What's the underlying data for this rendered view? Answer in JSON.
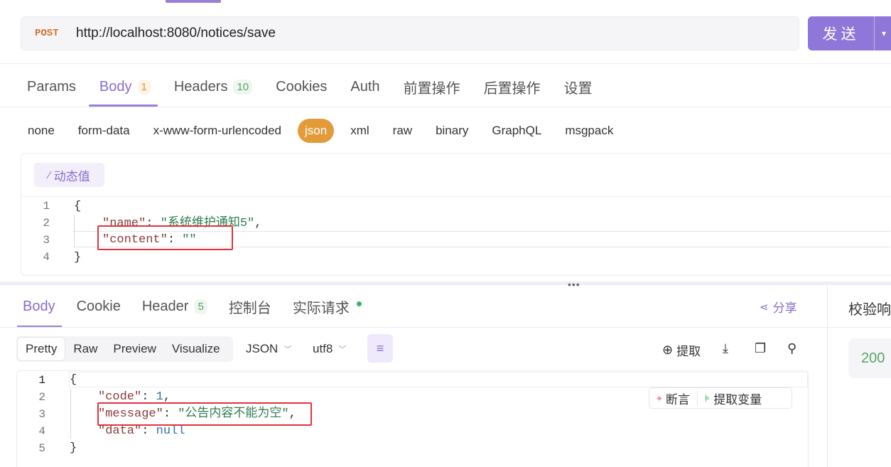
{
  "request": {
    "method": "POST",
    "url": "http://localhost:8080/notices/save",
    "send_label": "发送"
  },
  "req_tabs": [
    {
      "label": "Params"
    },
    {
      "label": "Body",
      "badge": "1"
    },
    {
      "label": "Headers",
      "badge": "10"
    },
    {
      "label": "Cookies"
    },
    {
      "label": "Auth"
    },
    {
      "label": "前置操作"
    },
    {
      "label": "后置操作"
    },
    {
      "label": "设置"
    }
  ],
  "body_types": [
    "none",
    "form-data",
    "x-www-form-urlencoded",
    "json",
    "xml",
    "raw",
    "binary",
    "GraphQL",
    "msgpack"
  ],
  "active_body_type": "json",
  "dynamic_value_label": "动态值",
  "request_body": {
    "line_numbers": [
      "1",
      "2",
      "3",
      "4"
    ],
    "open": "{",
    "name_key": "\"name\"",
    "name_value": "\"系统维护通知5\"",
    "content_key": "\"content\"",
    "content_value": "\"\"",
    "close": "}"
  },
  "resp_tabs": [
    {
      "label": "Body"
    },
    {
      "label": "Cookie"
    },
    {
      "label": "Header",
      "badge": "5"
    },
    {
      "label": "控制台"
    },
    {
      "label": "实际请求"
    }
  ],
  "share_label": "分享",
  "verify_label": "校验响",
  "status_code": "200",
  "view_modes": [
    "Pretty",
    "Raw",
    "Preview",
    "Visualize"
  ],
  "format_select": "JSON",
  "encoding_select": "utf8",
  "extract_label": "提取",
  "float_tools": {
    "assert": "断言",
    "extract_var": "提取变量"
  },
  "response_body": {
    "line_numbers": [
      "1",
      "2",
      "3",
      "4",
      "5"
    ],
    "open": "{",
    "code_key": "\"code\"",
    "code_value": "1",
    "message_key": "\"message\"",
    "message_value": "\"公告内容不能为空\"",
    "data_key": "\"data\"",
    "data_value": "null",
    "close": "}"
  },
  "colors": {
    "accent": "#8e77d8",
    "method": "#d5712f",
    "active_body_type_bg": "#e39b3a",
    "highlight_box": "#e0323e",
    "status_ok": "#57a36a"
  }
}
